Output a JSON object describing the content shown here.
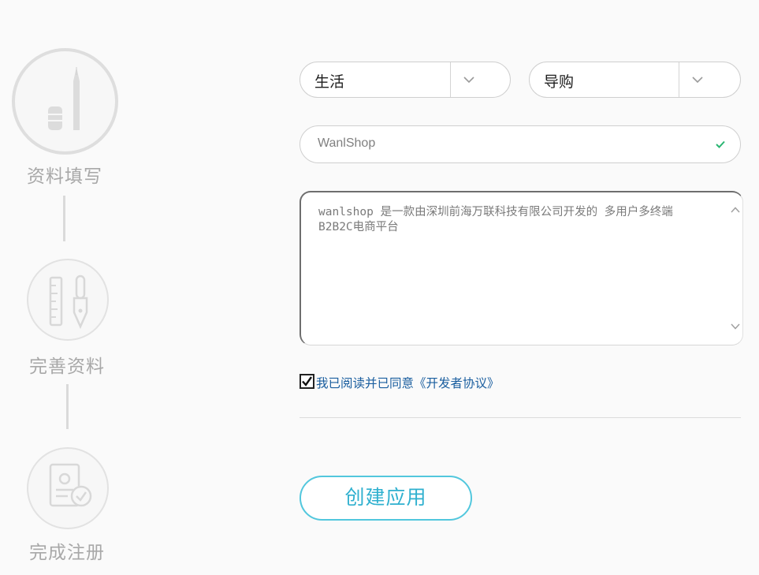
{
  "steps": [
    {
      "label": "资料填写",
      "icon": "pen-and-eraser-icon",
      "state": "active"
    },
    {
      "label": "完善资料",
      "icon": "ruler-and-pen-icon",
      "state": "pending"
    },
    {
      "label": "完成注册",
      "icon": "document-check-icon",
      "state": "pending"
    }
  ],
  "form": {
    "category_primary": {
      "value": "生活"
    },
    "category_secondary": {
      "value": "导购"
    },
    "app_name": {
      "value": "WanlShop",
      "valid": true
    },
    "description": {
      "value": "wanlshop 是一款由深圳前海万联科技有限公司开发的 多用户多终端 B2B2C电商平台"
    },
    "agreement": {
      "checked": true,
      "label": "我已阅读并已同意《开发者协议》"
    },
    "submit_label": "创建应用"
  },
  "colors": {
    "accent": "#2fb0cf",
    "link": "#1a5e9f",
    "valid": "#2bb673",
    "muted": "#a8a8a8"
  }
}
